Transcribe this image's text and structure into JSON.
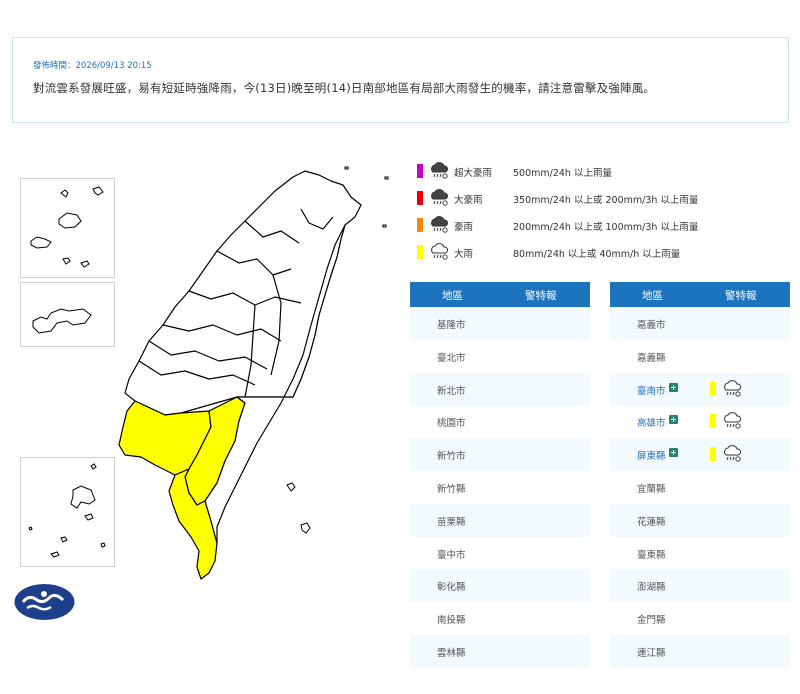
{
  "notice": {
    "time_label": "發佈時間：2026/09/13 20:15",
    "message": "對流雲系發展旺盛，易有短延時強降雨，今(13日)晚至明(14)日南部地區有局部大雨發生的機率，請注意雷擊及強陣風。"
  },
  "legend": [
    {
      "name": "超大豪雨",
      "range": "500mm/24h 以上雨量",
      "color": "#cc00cc",
      "icon": "heavy-rain-cloud-icon"
    },
    {
      "name": "大豪雨",
      "range": "350mm/24h 以上或 200mm/3h 以上雨量",
      "color": "#ee0000",
      "icon": "heavy-rain-cloud-icon"
    },
    {
      "name": "豪雨",
      "range": "200mm/24h 以上或 100mm/3h 以上雨量",
      "color": "#ff8800",
      "icon": "heavy-rain-cloud-icon"
    },
    {
      "name": "大雨",
      "range": "80mm/24h 以上或 40mm/h 以上雨量",
      "color": "#ffff00",
      "icon": "rain-cloud-icon"
    }
  ],
  "table_headers": {
    "area": "地區",
    "warning": "警特報"
  },
  "left_table": [
    {
      "city": "基隆市",
      "warning": false
    },
    {
      "city": "臺北市",
      "warning": false
    },
    {
      "city": "新北市",
      "warning": false
    },
    {
      "city": "桃園市",
      "warning": false
    },
    {
      "city": "新竹市",
      "warning": false
    },
    {
      "city": "新竹縣",
      "warning": false
    },
    {
      "city": "苗栗縣",
      "warning": false
    },
    {
      "city": "臺中市",
      "warning": false
    },
    {
      "city": "彰化縣",
      "warning": false
    },
    {
      "city": "南投縣",
      "warning": false
    },
    {
      "city": "雲林縣",
      "warning": false
    }
  ],
  "right_table": [
    {
      "city": "嘉義市",
      "warning": false
    },
    {
      "city": "嘉義縣",
      "warning": false
    },
    {
      "city": "臺南市",
      "warning": true
    },
    {
      "city": "高雄市",
      "warning": true
    },
    {
      "city": "屏東縣",
      "warning": true
    },
    {
      "city": "宜蘭縣",
      "warning": false
    },
    {
      "city": "花蓮縣",
      "warning": false
    },
    {
      "city": "臺東縣",
      "warning": false
    },
    {
      "city": "澎湖縣",
      "warning": false
    },
    {
      "city": "金門縣",
      "warning": false
    },
    {
      "city": "連江縣",
      "warning": false
    }
  ],
  "colors": {
    "accent": "#1e73be",
    "warning_fill": "#ffff00",
    "plus": "#2a7f6c"
  }
}
